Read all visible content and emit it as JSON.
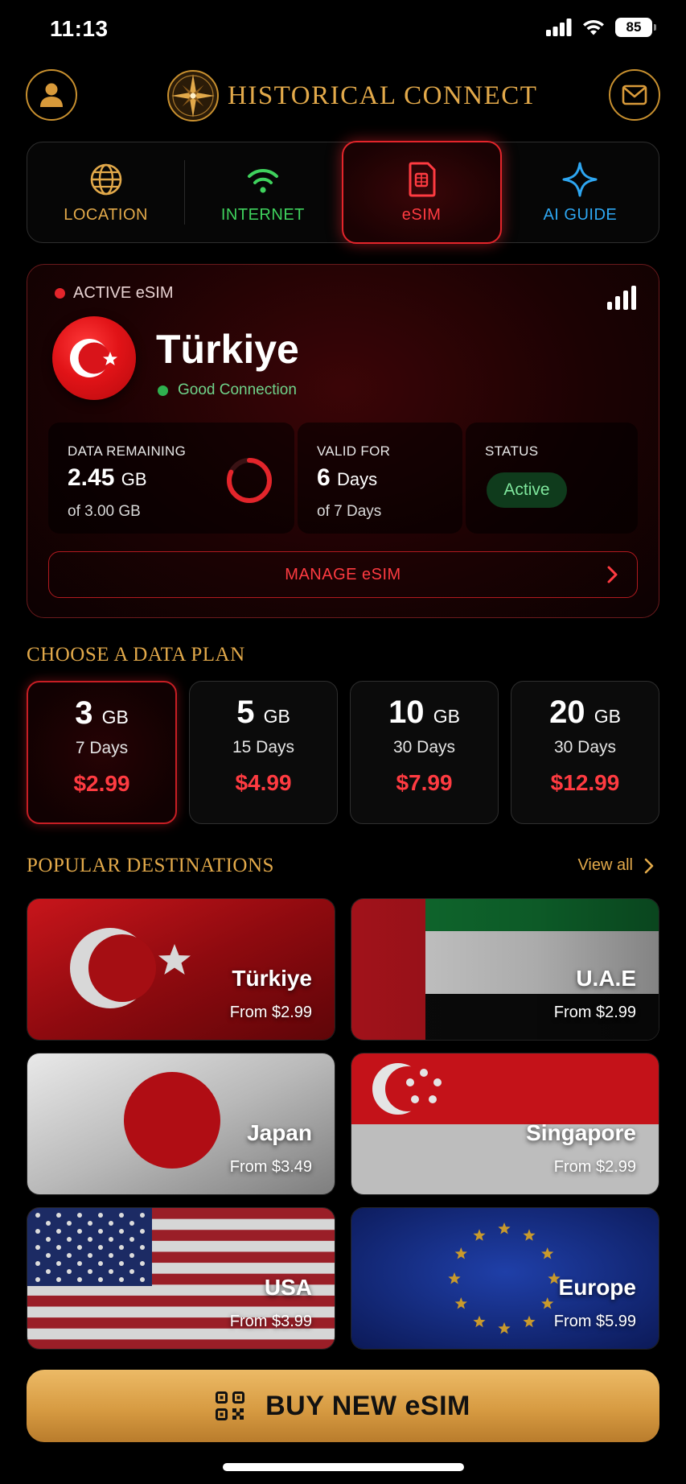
{
  "status_bar": {
    "time": "11:13",
    "battery": "85"
  },
  "header": {
    "brand_title": "HISTORICAL CONNECT",
    "profile_icon": "person-icon",
    "mail_icon": "mail-icon"
  },
  "tabs": [
    {
      "label": "LOCATION",
      "icon": "globe-icon",
      "color": "#e2a94a"
    },
    {
      "label": "INTERNET",
      "icon": "wifi-icon",
      "color": "#3fd25d"
    },
    {
      "label": "eSIM",
      "icon": "sim-card-icon",
      "color": "#ff3b41",
      "active": true
    },
    {
      "label": "AI GUIDE",
      "icon": "sparkle-icon",
      "color": "#2ea7f2"
    }
  ],
  "active_esim": {
    "label": "ACTIVE eSIM",
    "country": "Türkiye",
    "connection": "Good Connection",
    "data": {
      "label": "DATA REMAINING",
      "value": "2.45",
      "unit": "GB",
      "sub": "of 3.00 GB",
      "fraction_remaining": 0.8167
    },
    "valid": {
      "label": "VALID FOR",
      "value": "6",
      "unit": "Days",
      "sub": "of 7 Days"
    },
    "status": {
      "label": "STATUS",
      "value": "Active"
    },
    "manage_label": "MANAGE eSIM"
  },
  "plans_section": {
    "title": "CHOOSE A DATA PLAN",
    "plans": [
      {
        "size": "3",
        "unit": "GB",
        "days": "7 Days",
        "price": "$2.99",
        "selected": true
      },
      {
        "size": "5",
        "unit": "GB",
        "days": "15 Days",
        "price": "$4.99"
      },
      {
        "size": "10",
        "unit": "GB",
        "days": "30 Days",
        "price": "$7.99"
      },
      {
        "size": "20",
        "unit": "GB",
        "days": "30 Days",
        "price": "$12.99"
      }
    ]
  },
  "destinations_section": {
    "title": "POPULAR DESTINATIONS",
    "view_all": "View all",
    "items": [
      {
        "name": "Türkiye",
        "price": "From $2.99"
      },
      {
        "name": "U.A.E",
        "price": "From $2.99"
      },
      {
        "name": "Japan",
        "price": "From $3.49"
      },
      {
        "name": "Singapore",
        "price": "From $2.99"
      },
      {
        "name": "USA",
        "price": "From $3.99"
      },
      {
        "name": "Europe",
        "price": "From $5.99"
      }
    ]
  },
  "buy_button": {
    "label": "BUY NEW eSIM",
    "icon": "qr-code-icon"
  },
  "colors": {
    "gold": "#e2a94a",
    "red": "#ff3b41",
    "green": "#3fd25d",
    "blue": "#2ea7f2"
  }
}
